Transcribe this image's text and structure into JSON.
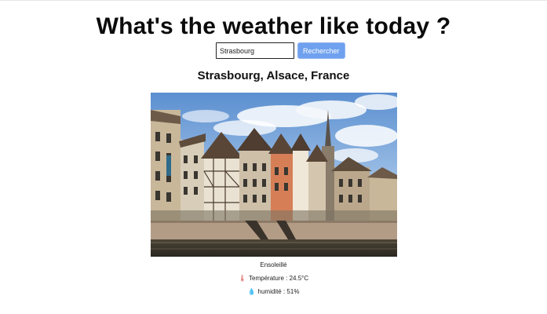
{
  "header": {
    "title": "What's the weather like today ?"
  },
  "search": {
    "value": "Strasbourg",
    "button_label": "Rechercher"
  },
  "location": {
    "name": "Strasbourg, Alsace, France"
  },
  "weather": {
    "condition": "Ensoleillé",
    "temperature_text": "Température : 24.5°C",
    "humidity_text": "humidité : 51%"
  },
  "icons": {
    "temperature": "thermometer-icon",
    "humidity": "water-drop-icon"
  }
}
